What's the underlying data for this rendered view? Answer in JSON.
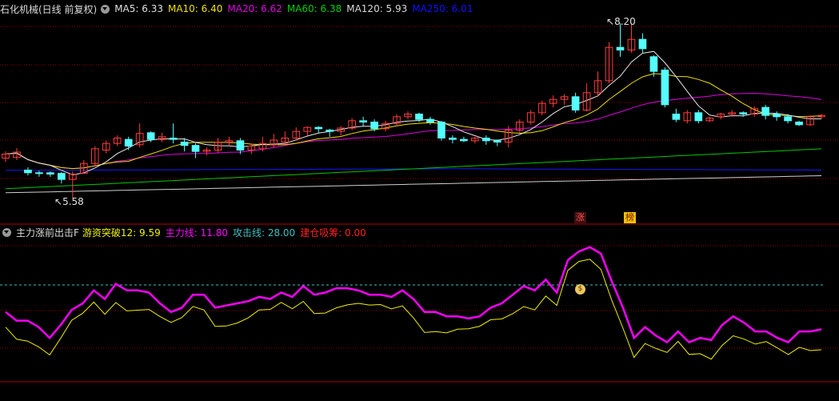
{
  "main_legend": {
    "title": "石化机械(日线 前复权)",
    "items": [
      {
        "label": "MA5:",
        "value": "6.33",
        "color": "#e0e0e0"
      },
      {
        "label": "MA10:",
        "value": "6.40",
        "color": "#f0e000"
      },
      {
        "label": "MA20:",
        "value": "6.62",
        "color": "#e000e0"
      },
      {
        "label": "MA60:",
        "value": "6.38",
        "color": "#00d000"
      },
      {
        "label": "MA120:",
        "value": "5.93",
        "color": "#d8d8d8"
      },
      {
        "label": "MA250:",
        "value": "6.01",
        "color": "#1010ff"
      }
    ]
  },
  "price_marks": {
    "high": "8.20",
    "low": "5.58"
  },
  "badges": {
    "zhang": "涨",
    "bang": "榜"
  },
  "sub_legend": {
    "title": "主力涨前出击F",
    "items": [
      {
        "label": "游资突破12:",
        "value": "9.59",
        "color": "#f0f000"
      },
      {
        "label": "主力线:",
        "value": "11.80",
        "color": "#ff00ff"
      },
      {
        "label": "攻击线:",
        "value": "28.00",
        "color": "#40c0c0"
      },
      {
        "label": "建仓吸筹:",
        "value": "0.00",
        "color": "#ff2020"
      }
    ]
  },
  "colors": {
    "up": "#ff3c3c",
    "down": "#54ffff",
    "grid": "#8b0000",
    "border": "#b00000"
  },
  "candles": [
    [
      6.18,
      6.24,
      6.28,
      6.12
    ],
    [
      6.19,
      6.27,
      6.33,
      6.15
    ],
    [
      6.0,
      5.96,
      6.04,
      5.92
    ],
    [
      5.96,
      5.95,
      5.99,
      5.9
    ],
    [
      5.96,
      5.94,
      5.98,
      5.9
    ],
    [
      5.95,
      5.86,
      5.97,
      5.8
    ],
    [
      5.86,
      5.94,
      5.98,
      5.58
    ],
    [
      5.95,
      6.1,
      6.15,
      5.95
    ],
    [
      6.1,
      6.32,
      6.36,
      6.05
    ],
    [
      6.3,
      6.4,
      6.44,
      6.25
    ],
    [
      6.4,
      6.48,
      6.52,
      6.36
    ],
    [
      6.46,
      6.36,
      6.5,
      6.3
    ],
    [
      6.38,
      6.55,
      6.7,
      6.34
    ],
    [
      6.56,
      6.46,
      6.58,
      6.42
    ],
    [
      6.46,
      6.5,
      6.56,
      6.42
    ],
    [
      6.48,
      6.46,
      6.7,
      6.4
    ],
    [
      6.42,
      6.37,
      6.48,
      6.28
    ],
    [
      6.37,
      6.28,
      6.4,
      6.18
    ],
    [
      6.28,
      6.3,
      6.34,
      6.22
    ],
    [
      6.3,
      6.42,
      6.48,
      6.26
    ],
    [
      6.42,
      6.44,
      6.5,
      6.36
    ],
    [
      6.44,
      6.3,
      6.48,
      6.24
    ],
    [
      6.3,
      6.36,
      6.4,
      6.24
    ],
    [
      6.32,
      6.4,
      6.5,
      6.28
    ],
    [
      6.38,
      6.45,
      6.54,
      6.34
    ],
    [
      6.42,
      6.48,
      6.58,
      6.38
    ],
    [
      6.48,
      6.58,
      6.64,
      6.44
    ],
    [
      6.58,
      6.64,
      6.66,
      6.52
    ],
    [
      6.64,
      6.62,
      6.66,
      6.56
    ],
    [
      6.6,
      6.58,
      6.62,
      6.5
    ],
    [
      6.58,
      6.63,
      6.66,
      6.52
    ],
    [
      6.63,
      6.74,
      6.78,
      6.6
    ],
    [
      6.74,
      6.72,
      6.8,
      6.66
    ],
    [
      6.72,
      6.62,
      6.76,
      6.58
    ],
    [
      6.62,
      6.7,
      6.74,
      6.58
    ],
    [
      6.7,
      6.8,
      6.84,
      6.66
    ],
    [
      6.8,
      6.84,
      6.88,
      6.76
    ],
    [
      6.84,
      6.76,
      6.86,
      6.72
    ],
    [
      6.76,
      6.72,
      6.8,
      6.68
    ],
    [
      6.72,
      6.48,
      6.74,
      6.44
    ],
    [
      6.48,
      6.46,
      6.52,
      6.4
    ],
    [
      6.46,
      6.44,
      6.5,
      6.42
    ],
    [
      6.44,
      6.48,
      6.5,
      6.4
    ],
    [
      6.48,
      6.44,
      6.52,
      6.38
    ],
    [
      6.44,
      6.42,
      6.46,
      6.36
    ],
    [
      6.42,
      6.6,
      6.66,
      6.34
    ],
    [
      6.6,
      6.72,
      6.76,
      6.56
    ],
    [
      6.72,
      6.86,
      6.9,
      6.68
    ],
    [
      6.86,
      7.0,
      7.04,
      6.82
    ],
    [
      7.0,
      7.06,
      7.12,
      6.94
    ],
    [
      7.06,
      7.1,
      7.14,
      6.98
    ],
    [
      7.1,
      6.9,
      7.16,
      6.86
    ],
    [
      6.9,
      7.16,
      7.3,
      6.88
    ],
    [
      7.16,
      7.34,
      7.48,
      7.1
    ],
    [
      7.34,
      7.84,
      7.92,
      7.3
    ],
    [
      7.84,
      7.8,
      8.2,
      7.7
    ],
    [
      7.8,
      7.96,
      8.2,
      7.76
    ],
    [
      7.96,
      7.82,
      8.05,
      7.76
    ],
    [
      7.7,
      7.48,
      7.72,
      7.4
    ],
    [
      7.5,
      6.98,
      7.54,
      6.94
    ],
    [
      6.84,
      6.76,
      6.92,
      6.72
    ],
    [
      6.74,
      6.86,
      6.9,
      6.7
    ],
    [
      6.86,
      6.74,
      6.9,
      6.7
    ],
    [
      6.74,
      6.78,
      6.8,
      6.72
    ],
    [
      6.8,
      6.84,
      6.86,
      6.76
    ],
    [
      6.84,
      6.86,
      6.9,
      6.8
    ],
    [
      6.86,
      6.84,
      6.88,
      6.8
    ],
    [
      6.84,
      6.92,
      6.96,
      6.8
    ],
    [
      6.94,
      6.82,
      6.98,
      6.76
    ],
    [
      6.84,
      6.8,
      6.88,
      6.74
    ],
    [
      6.8,
      6.74,
      6.84,
      6.7
    ],
    [
      6.72,
      6.68,
      6.74,
      6.66
    ],
    [
      6.68,
      6.8,
      6.82,
      6.66
    ],
    [
      6.8,
      6.82,
      6.84,
      6.76
    ]
  ],
  "magenta_line": [
    9.6,
    9.2,
    9.2,
    8.9,
    8.4,
    9.0,
    9.7,
    10.0,
    10.6,
    10.2,
    10.9,
    10.6,
    10.6,
    10.5,
    10.0,
    9.6,
    9.8,
    10.4,
    10.4,
    9.8,
    9.9,
    10.0,
    10.1,
    10.3,
    10.2,
    10.5,
    10.3,
    10.8,
    10.4,
    10.5,
    10.7,
    10.7,
    10.6,
    10.4,
    10.4,
    10.3,
    10.6,
    10.2,
    9.6,
    9.6,
    9.4,
    9.4,
    9.3,
    9.4,
    9.8,
    10.0,
    10.4,
    10.8,
    10.6,
    11.1,
    10.5,
    12.0,
    12.4,
    12.6,
    12.3,
    11.0,
    9.8,
    8.4,
    8.9,
    8.5,
    8.2,
    8.7,
    8.2,
    8.4,
    8.3,
    9.0,
    9.4,
    9.1,
    8.7,
    8.7,
    8.4,
    8.2,
    8.7,
    8.7,
    8.8
  ]
}
